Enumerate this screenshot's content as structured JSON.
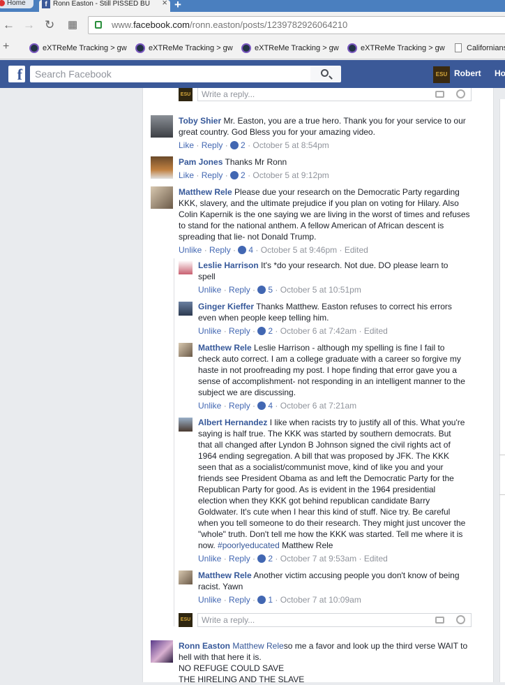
{
  "browser": {
    "tab_inactive": "Home",
    "tab_active": "Ronn Easton - Still PISSED BU",
    "url_prefix": "www.",
    "url_host": "facebook.com",
    "url_path": "/ronn.easton/posts/1239782926064210"
  },
  "bookmarks": [
    {
      "label": "eXTReMe Tracking > gw"
    },
    {
      "label": "eXTReMe Tracking > gw"
    },
    {
      "label": "eXTReMe Tracking > gw"
    },
    {
      "label": "eXTReMe Tracking > gw"
    },
    {
      "label": "Californians"
    }
  ],
  "fb": {
    "search_placeholder": "Search Facebook",
    "user": "Robert",
    "home": "Ho",
    "avatar_text": "ESU"
  },
  "reply_placeholder": "Write a reply...",
  "comments": [
    {
      "name": "Toby Shier",
      "text": " Mr. Easton, you are a true hero. Thank you for your service to our great country. God Bless you for your amazing video.",
      "like": "Like",
      "reply": "Reply",
      "count": "2",
      "time": "October 5 at 8:54pm",
      "edited": ""
    },
    {
      "name": "Pam Jones",
      "text": " Thanks Mr Ronn",
      "like": "Like",
      "reply": "Reply",
      "count": "2",
      "time": "October 5 at 9:12pm",
      "edited": ""
    },
    {
      "name": "Matthew Rele",
      "text": " Please due your research on the Democratic Party regarding KKK, slavery, and the ultimate prejudice if you plan on voting for Hilary. Also Colin Kapernik is the one saying we are living in the worst of times and refuses to stand for the national anthem. A fellow American of African descent is spreading that lie- not Donald Trump.",
      "like": "Unlike",
      "reply": "Reply",
      "count": "4",
      "time": "October 5 at 9:46pm",
      "edited": "Edited"
    }
  ],
  "replies": [
    {
      "name": "Leslie Harrison",
      "text": " It's *do your research. Not due. DO please learn to spell",
      "like": "Unlike",
      "reply": "Reply",
      "count": "5",
      "time": "October 5 at 10:51pm",
      "edited": ""
    },
    {
      "name": "Ginger Kieffer",
      "text": " Thanks Matthew. Easton refuses to correct his errors even when people keep telling him.",
      "like": "Unlike",
      "reply": "Reply",
      "count": "2",
      "time": "October 6 at 7:42am",
      "edited": "Edited"
    },
    {
      "name": "Matthew Rele",
      "text": " Leslie Harrison - although my spelling is fine I fail to check auto correct. I am a college graduate with a career so forgive my haste in not proofreading my post. I hope finding that error gave you a sense of accomplishment- not responding in an intelligent manner to the subject we are discussing.",
      "like": "Unlike",
      "reply": "Reply",
      "count": "4",
      "time": "October 6 at 7:21am",
      "edited": ""
    },
    {
      "name": "Albert Hernandez",
      "text": " I like when racists try to justify all of this. What you're saying is half true. The KKK was started by southern democrats. But that all changed after Lyndon B Johnson signed the civil rights act of 1964 ending segregation. A bill that was proposed by JFK. The KKK seen that as a socialist/communist move, kind of like you and your friends see President Obama as and left the Democratic Party for the Republican Party for good. As is evident in the 1964 presidential election when they KKK got behind republican candidate Barry Goldwater. It's cute when I hear this kind of stuff. Nice try. Be careful when you tell someone to do their research. They might just uncover the \"whole\" truth. Don't tell me how the KKK was started. Tell me where it is now. ",
      "hashtag": "#poorlyeducated",
      "after": " Matthew Rele",
      "like": "Unlike",
      "reply": "Reply",
      "count": "2",
      "time": "October 7 at 9:53am",
      "edited": "Edited"
    },
    {
      "name": "Matthew Rele",
      "text": " Another victim accusing people you don't know of being racist. Yawn",
      "like": "Unlike",
      "reply": "Reply",
      "count": "1",
      "time": "October 7 at 10:09am",
      "edited": ""
    }
  ],
  "last": {
    "name": "Ronn Easton",
    "mention": " Matthew Rele",
    "text": "so me a favor and look up the third verse WAIT to hell with that here it is.",
    "line2": "NO REFUGE COULD SAVE",
    "line3": "THE HIRELING AND THE SLAVE"
  }
}
